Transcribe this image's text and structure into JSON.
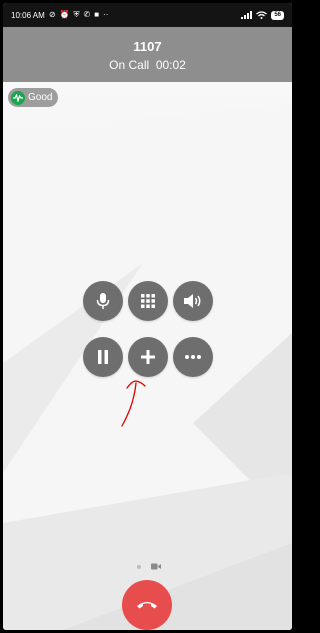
{
  "status_bar": {
    "time": "10:06 AM",
    "battery": "56",
    "left_icons": [
      "no-sim-icon",
      "alarm-icon",
      "shield-icon",
      "phone-icon",
      "video-icon",
      "more-dots-icon"
    ],
    "right_icons": [
      "signal-icon",
      "wifi-icon",
      "battery-icon"
    ]
  },
  "call": {
    "number": "1107",
    "status": "On Call  00:02"
  },
  "quality": {
    "label": "Good",
    "color": "#1aa64c"
  },
  "controls": {
    "row1": [
      "microphone-icon",
      "keypad-icon",
      "speaker-icon"
    ],
    "row2": [
      "pause-icon",
      "add-call-icon",
      "more-icon"
    ]
  },
  "annotation": {
    "color": "#e00000",
    "shape": "hand-drawn-arrow-up"
  },
  "colors": {
    "header_bg": "#8e8e8e",
    "button_bg": "#6e6e6e",
    "hangup_bg": "#e84d4d"
  }
}
